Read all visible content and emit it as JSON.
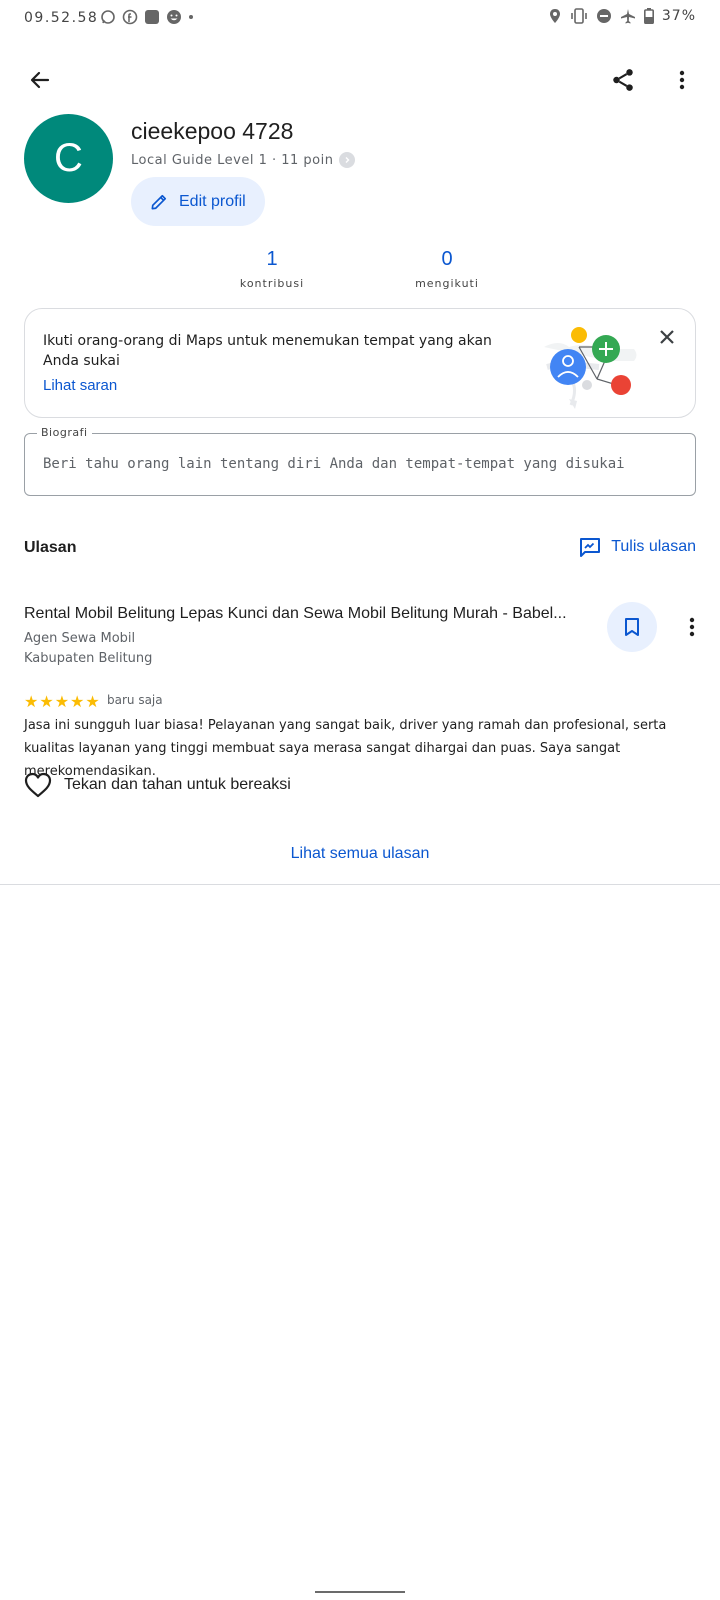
{
  "status_bar": {
    "time": "09.52.58",
    "battery": "37%"
  },
  "header": {
    "back_icon": "arrow-left-icon",
    "share_icon": "share-icon",
    "more_icon": "more-vert-icon"
  },
  "profile": {
    "avatar_letter": "C",
    "avatar_color": "#00897b",
    "name": "cieekepoo 4728",
    "level": "Local Guide Level 1 · 11 poin",
    "edit_label": "Edit profil"
  },
  "stats": [
    {
      "value": "1",
      "label": "kontribusi"
    },
    {
      "value": "0",
      "label": "mengikuti"
    }
  ],
  "suggestion": {
    "text": "Ikuti orang-orang di Maps untuk menemukan tempat yang akan Anda sukai",
    "link": "Lihat saran"
  },
  "bio": {
    "label": "Biografi",
    "placeholder": "Beri tahu orang lain tentang diri Anda dan tempat-tempat yang disukai"
  },
  "reviews": {
    "title": "Ulasan",
    "write_label": "Tulis ulasan",
    "item": {
      "place": "Rental Mobil Belitung Lepas Kunci dan Sewa Mobil Belitung Murah - Babel...",
      "category": "Agen Sewa Mobil",
      "location": "Kabupaten Belitung",
      "rating": 5,
      "time": "baru saja",
      "text": "Jasa ini sungguh luar biasa! Pelayanan yang sangat baik, driver yang ramah dan profesional, serta kualitas layanan yang tinggi membuat saya merasa sangat dihargai dan puas. Saya sangat merekomendasikan.",
      "react_label": "Tekan dan tahan untuk bereaksi"
    },
    "see_all": "Lihat semua ulasan"
  },
  "colors": {
    "accent": "#0b57d0",
    "star": "#fbbc04"
  }
}
